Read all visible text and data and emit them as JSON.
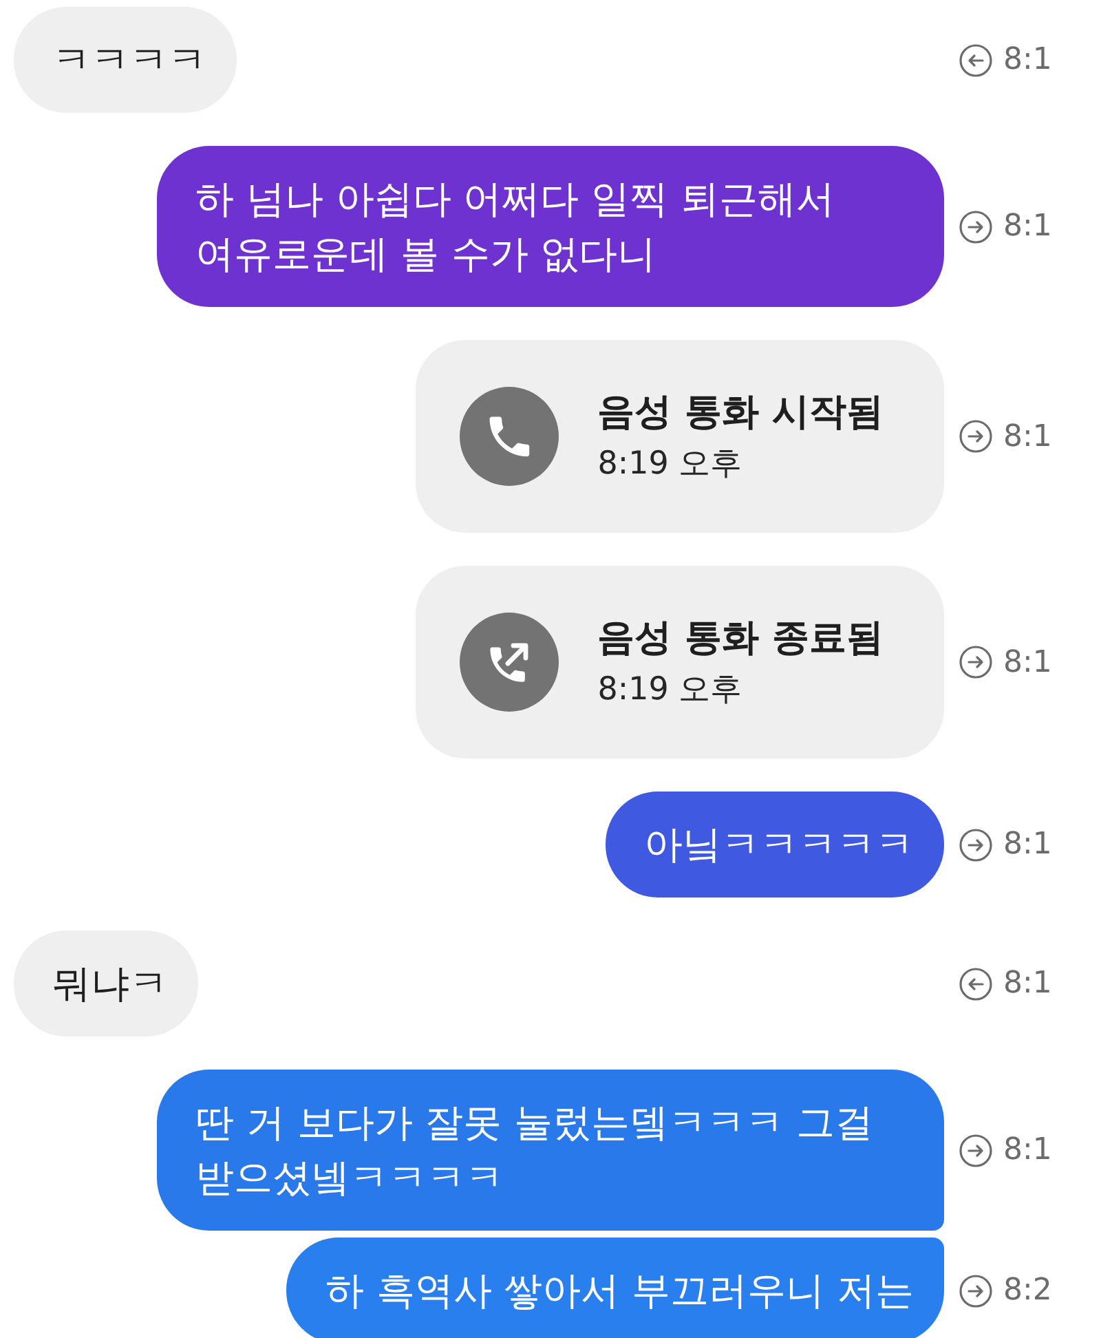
{
  "messages": [
    {
      "kind": "text",
      "outgoing": false,
      "text": "ㅋㅋㅋㅋ",
      "time": "8:1"
    },
    {
      "kind": "text",
      "outgoing": true,
      "color": "#6e32d0",
      "text": "하 넘나 아쉽다 어쩌다 일찍 퇴근해서 여유로운데 볼 수가 없다니",
      "time": "8:1"
    },
    {
      "kind": "call",
      "outgoing": true,
      "ended": false,
      "title": "음성 통화 시작됨",
      "subtitle": "8:19 오후",
      "time": "8:1"
    },
    {
      "kind": "call",
      "outgoing": true,
      "ended": true,
      "title": "음성 통화 종료됨",
      "subtitle": "8:19 오후",
      "time": "8:1"
    },
    {
      "kind": "text",
      "outgoing": true,
      "color": "#3f5ae0",
      "text": "아닠ㅋㅋㅋㅋㅋ",
      "time": "8:1"
    },
    {
      "kind": "text",
      "outgoing": false,
      "text": "뭐냐ㅋ",
      "time": "8:1"
    },
    {
      "kind": "text",
      "outgoing": true,
      "color": "#2a79ea",
      "text": "딴 거 보다가 잘못 눌렀는뎈ㅋㅋㅋ 그걸 받으셨넼ㅋㅋㅋㅋ",
      "time": "8:1"
    },
    {
      "kind": "text",
      "outgoing": true,
      "color": "#2a7fee",
      "text": "하 흑역사 쌓아서 부끄러우니 저는",
      "time": "8:2"
    }
  ]
}
